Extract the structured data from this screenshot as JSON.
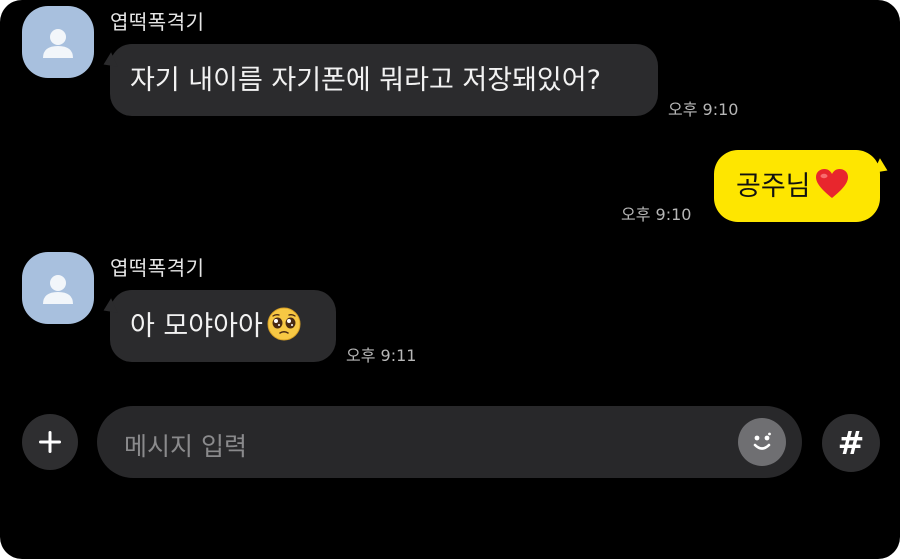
{
  "messages": [
    {
      "sender": "엽떡폭격기",
      "text": "자기 내이름 자기폰에 뭐라고 저장돼있어?",
      "time": "오후 9:10",
      "direction": "incoming"
    },
    {
      "text": "공주님",
      "emoji": "red-heart",
      "time": "오후 9:10",
      "direction": "outgoing"
    },
    {
      "sender": "엽떡폭격기",
      "text": "아 모야아아",
      "emoji": "pleading-face",
      "time": "오후 9:11",
      "direction": "incoming"
    }
  ],
  "input": {
    "placeholder": "메시지 입력"
  },
  "buttons": {
    "hash_label": "#"
  },
  "colors": {
    "background": "#000000",
    "incoming_bubble": "#2b2b2d",
    "outgoing_bubble": "#fee600",
    "avatar": "#a8c0de"
  }
}
